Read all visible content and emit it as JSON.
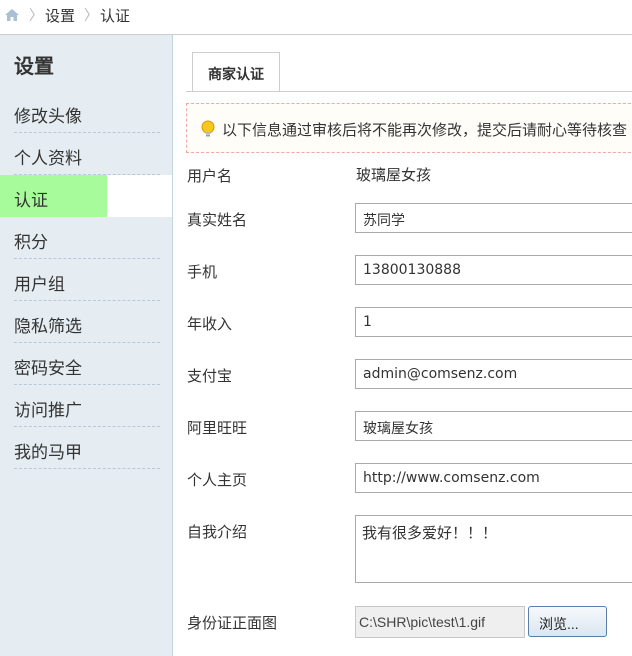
{
  "breadcrumb": {
    "home_icon": "home-icon",
    "items": [
      "设置",
      "认证"
    ],
    "separator": "〉"
  },
  "sidebar": {
    "title": "设置",
    "items": [
      {
        "label": "修改头像"
      },
      {
        "label": "个人资料"
      },
      {
        "label": "认证",
        "active": true
      },
      {
        "label": "积分"
      },
      {
        "label": "用户组"
      },
      {
        "label": "隐私筛选"
      },
      {
        "label": "密码安全"
      },
      {
        "label": "访问推广"
      },
      {
        "label": "我的马甲"
      }
    ]
  },
  "tab": {
    "label": "商家认证"
  },
  "notice": {
    "icon": "lightbulb-icon",
    "text": "以下信息通过审核后将不能再次修改，提交后请耐心等待核查"
  },
  "form": {
    "username": {
      "label": "用户名",
      "value": "玻璃屋女孩"
    },
    "realname": {
      "label": "真实姓名",
      "value": "苏同学"
    },
    "phone": {
      "label": "手机",
      "value": "13800130888"
    },
    "income": {
      "label": "年收入",
      "value": "1"
    },
    "alipay": {
      "label": "支付宝",
      "value": "admin@comsenz.com"
    },
    "aliwangwang": {
      "label": "阿里旺旺",
      "value": "玻璃屋女孩"
    },
    "homepage": {
      "label": "个人主页",
      "value": "http://www.comsenz.com"
    },
    "bio": {
      "label": "自我介绍",
      "value": "我有很多爱好！！！"
    },
    "idcard": {
      "label": "身份证正面图",
      "value": "C:\\SHR\\pic\\test\\1.gif",
      "button": "浏览..."
    }
  },
  "colors": {
    "sidebar_bg": "#e5edf2",
    "active_highlight": "#a8fb9b",
    "notice_border": "#f3a6a6"
  }
}
